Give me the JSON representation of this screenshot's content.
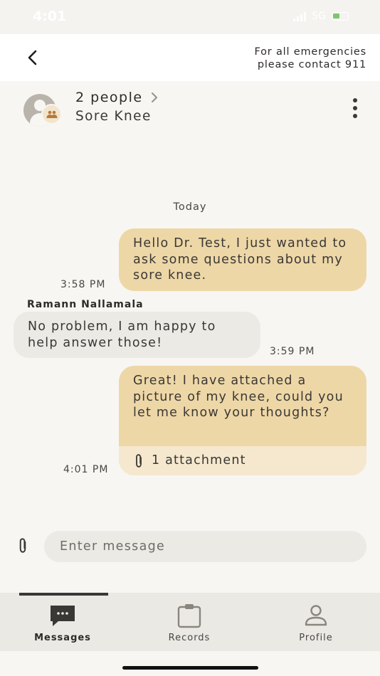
{
  "status_bar": {
    "time": "4:01",
    "network": "5G"
  },
  "nav": {
    "back_icon": "chevron-left-icon",
    "emergency_line1": "For all emergencies",
    "emergency_line2": "please contact 911"
  },
  "conversation": {
    "title": "2 people",
    "subtitle": "Sore Knee",
    "avatar_icon": "group-avatar-icon",
    "menu_icon": "more-vertical-icon"
  },
  "thread": {
    "date_label": "Today",
    "messages": [
      {
        "direction": "outgoing",
        "text": "Hello Dr. Test, I just wanted to ask some questions about my sore knee.",
        "time": "3:58 PM"
      },
      {
        "direction": "incoming",
        "sender": "Ramann Nallamala",
        "text": "No problem, I am happy to help answer those!",
        "time": "3:59 PM"
      },
      {
        "direction": "outgoing",
        "text": "Great! I have attached a picture of my knee, could you let me know your thoughts?",
        "attachment_label": "1 attachment",
        "time": "4:01 PM"
      }
    ]
  },
  "composer": {
    "placeholder": "Enter message",
    "attach_icon": "paperclip-icon"
  },
  "tabs": [
    {
      "label": "Messages",
      "icon": "chat-bubble-icon",
      "active": true
    },
    {
      "label": "Records",
      "icon": "clipboard-icon",
      "active": false
    },
    {
      "label": "Profile",
      "icon": "person-icon",
      "active": false
    }
  ],
  "colors": {
    "outgoing_bubble": "#eed7a7",
    "attachment_strip": "#f5e8ce",
    "incoming_bubble": "#ebeae5",
    "text": "#3a3835"
  }
}
